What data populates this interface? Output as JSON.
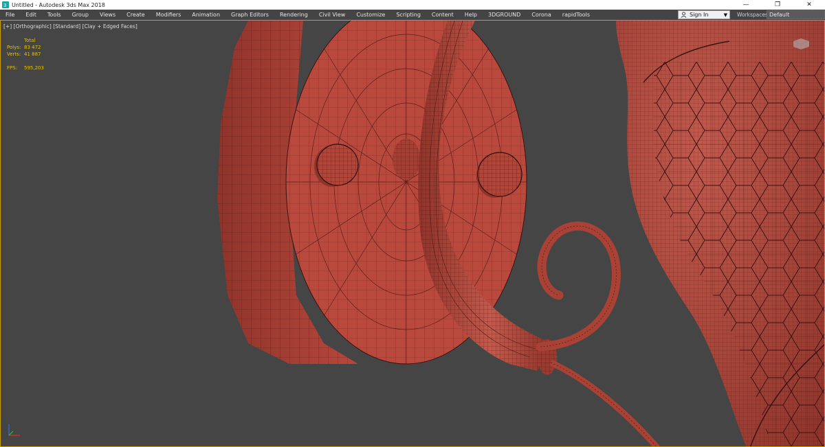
{
  "window": {
    "title": "Untitled - Autodesk 3ds Max 2018",
    "controls": {
      "minimize": "—",
      "restore": "❐",
      "close": "✕"
    }
  },
  "menu": {
    "items": [
      "File",
      "Edit",
      "Tools",
      "Group",
      "Views",
      "Create",
      "Modifiers",
      "Animation",
      "Graph Editors",
      "Rendering",
      "Civil View",
      "Customize",
      "Scripting",
      "Content",
      "Help",
      "3DGROUND",
      "Corona",
      "rapidTools"
    ],
    "signin_label": "Sign In",
    "workspaces_label": "Workspaces:",
    "workspace_value": "Default"
  },
  "viewport": {
    "label_plus": "[+]",
    "label_view": "[Orthographic]",
    "label_shading_mode": "[Standard]",
    "label_shading": "[Clay + Edged Faces]",
    "stats": {
      "header": "Total",
      "polys_label": "Polys:",
      "polys_value": "83 472",
      "verts_label": "Verts:",
      "verts_value": "41 887",
      "fps_label": "FPS:",
      "fps_value": "595,203"
    }
  },
  "colors": {
    "viewport_bg": "#454545",
    "clay": "#b5493c",
    "wire": "#3a1210",
    "stats_text": "#e5c300",
    "active_border": "#c8a000"
  }
}
